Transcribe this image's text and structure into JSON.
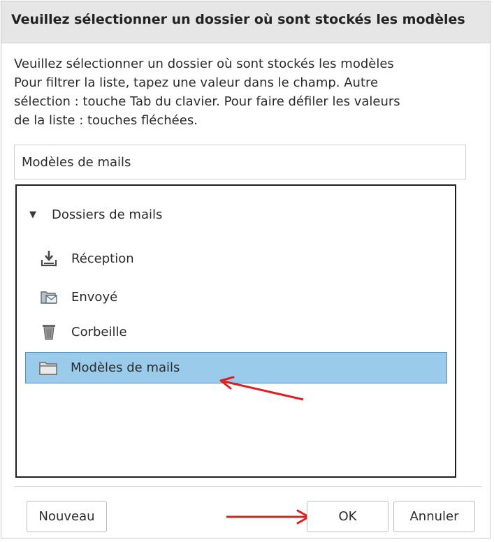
{
  "dialog": {
    "title": "Veuillez sélectionner un dossier où sont stockés les modèles"
  },
  "description": {
    "lines": [
      "Veuillez sélectionner un dossier où sont stockés les modèles",
      "Pour filtrer la liste, tapez une valeur dans le champ. Autre",
      "sélection : touche Tab du clavier. Pour faire défiler les valeurs",
      "de la liste : touches fléchées."
    ]
  },
  "filter": {
    "value": "Modèles de mails"
  },
  "tree": {
    "root_label": "Dossiers de mails",
    "root_expanded": true,
    "items": [
      {
        "label": "Réception",
        "icon": "inbox-download-icon",
        "selected": false
      },
      {
        "label": "Envoyé",
        "icon": "sent-folder-icon",
        "selected": false
      },
      {
        "label": "Corbeille",
        "icon": "trash-icon",
        "selected": false
      },
      {
        "label": "Modèles de mails",
        "icon": "folder-icon",
        "selected": true
      }
    ]
  },
  "buttons": {
    "new_label": "Nouveau",
    "ok_label": "OK",
    "cancel_label": "Annuler"
  },
  "colors": {
    "selection": "#9bcbea",
    "annotation_arrow": "#e02020",
    "titlebar": "#e6e6e6"
  }
}
